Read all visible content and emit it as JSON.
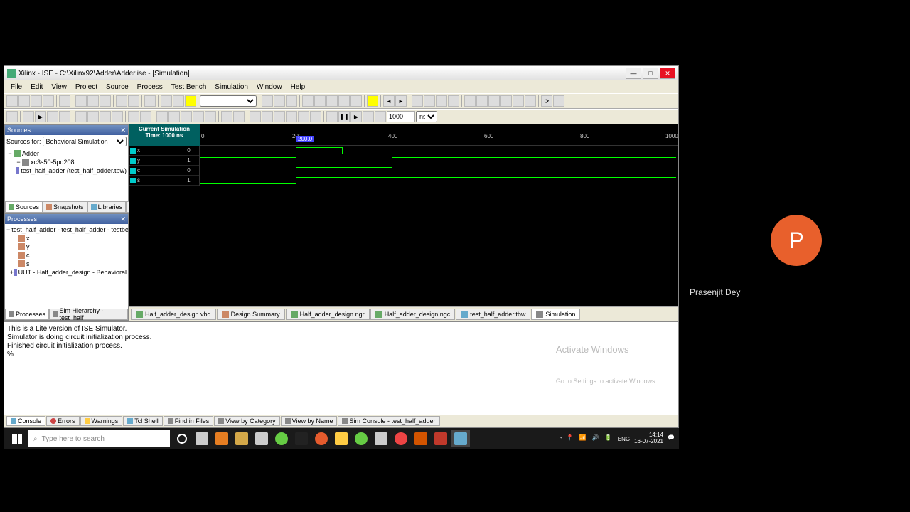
{
  "title": "Xilinx - ISE - C:\\Xilinx92\\Adder\\Adder.ise - [Simulation]",
  "menus": [
    "File",
    "Edit",
    "View",
    "Project",
    "Source",
    "Process",
    "Test Bench",
    "Simulation",
    "Window",
    "Help"
  ],
  "sources": {
    "header": "Sources",
    "for_label": "Sources for:",
    "for_value": "Behavioral Simulation",
    "tree": [
      {
        "indent": 0,
        "toggle": "−",
        "label": "Adder"
      },
      {
        "indent": 1,
        "toggle": "−",
        "label": "xc3s50-5pq208"
      },
      {
        "indent": 2,
        "toggle": "",
        "label": "test_half_adder (test_half_adder.tbw)"
      }
    ],
    "tabs": [
      "Sources",
      "Snapshots",
      "Libraries",
      "Design"
    ]
  },
  "processes": {
    "header": "Processes",
    "tree": [
      {
        "indent": 0,
        "toggle": "−",
        "label": "test_half_adder - test_half_adder - testbench_arch"
      },
      {
        "indent": 1,
        "toggle": "",
        "label": "x"
      },
      {
        "indent": 1,
        "toggle": "",
        "label": "y"
      },
      {
        "indent": 1,
        "toggle": "",
        "label": "c"
      },
      {
        "indent": 1,
        "toggle": "",
        "label": "s"
      },
      {
        "indent": 1,
        "toggle": "+",
        "label": "UUT - Half_adder_design - Behavioral"
      }
    ],
    "tabs": [
      "Processes",
      "Sim Hierarchy - test_half"
    ]
  },
  "wave": {
    "sim_label": "Current Simulation",
    "time_label": "Time: 1000 ns",
    "cursor": "200.0",
    "ticks": [
      "0",
      "200",
      "400",
      "600",
      "800",
      "1000"
    ],
    "signals": [
      {
        "name": "x",
        "value": "0"
      },
      {
        "name": "y",
        "value": "1"
      },
      {
        "name": "c",
        "value": "0"
      },
      {
        "name": "s",
        "value": "1"
      }
    ]
  },
  "sim_time_input": "1000",
  "sim_unit": "ns",
  "editor_tabs": [
    "Half_adder_design.vhd",
    "Design Summary",
    "Half_adder_design.ngr",
    "Half_adder_design.ngc",
    "test_half_adder.tbw",
    "Simulation"
  ],
  "console": {
    "lines": [
      "This is a Lite version of ISE Simulator.",
      "Simulator is doing circuit initialization process.",
      "Finished circuit initialization process.",
      "%"
    ],
    "watermark": "Activate Windows",
    "watermark_sub": "Go to Settings to activate Windows.",
    "tabs": [
      "Console",
      "Errors",
      "Warnings",
      "Tcl Shell",
      "Find in Files",
      "View by Category",
      "View by Name",
      "Sim Console - test_half_adder"
    ]
  },
  "taskbar": {
    "search_placeholder": "Type here to search",
    "lang": "ENG",
    "time": "14:14",
    "date": "16-07-2021"
  },
  "meeting": {
    "initial": "P",
    "name": "Prasenjit Dey"
  }
}
